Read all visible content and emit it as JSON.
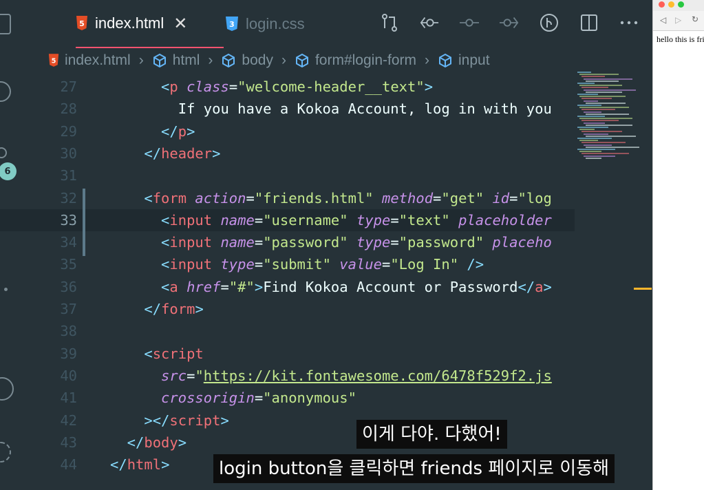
{
  "activity_bar": {
    "badge": "6"
  },
  "tabs": [
    {
      "label": "index.html",
      "icon": "html5-icon",
      "active": true
    },
    {
      "label": "login.css",
      "icon": "css3-icon",
      "active": false
    }
  ],
  "toolbar": [
    "compare-changes-icon",
    "go-back-commit-icon",
    "commit-icon",
    "go-forward-commit-icon",
    "git-lens-icon",
    "split-editor-icon",
    "more-icon"
  ],
  "breadcrumb": [
    "index.html",
    "html",
    "body",
    "form#login-form",
    "input"
  ],
  "editor": {
    "lines": [
      {
        "n": "27",
        "tokens": [
          [
            "t",
            "      <"
          ],
          [
            "n",
            "p"
          ],
          [
            "a",
            " class"
          ],
          [
            "p",
            "="
          ],
          [
            "s",
            "\"welcome-header__text\""
          ],
          [
            "t",
            ">"
          ]
        ]
      },
      {
        "n": "28",
        "tokens": [
          [
            "w",
            "        If you have a Kokoa Account, log in with you"
          ]
        ]
      },
      {
        "n": "29",
        "tokens": [
          [
            "t",
            "      </"
          ],
          [
            "n",
            "p"
          ],
          [
            "t",
            ">"
          ]
        ]
      },
      {
        "n": "30",
        "tokens": [
          [
            "t",
            "    </"
          ],
          [
            "n",
            "header"
          ],
          [
            "t",
            ">"
          ]
        ]
      },
      {
        "n": "31",
        "tokens": []
      },
      {
        "n": "32",
        "tokens": [
          [
            "t",
            "    <"
          ],
          [
            "n",
            "form"
          ],
          [
            "a",
            " action"
          ],
          [
            "p",
            "="
          ],
          [
            "s",
            "\"friends.html\""
          ],
          [
            "a",
            " method"
          ],
          [
            "p",
            "="
          ],
          [
            "s",
            "\"get\""
          ],
          [
            "a",
            " id"
          ],
          [
            "p",
            "="
          ],
          [
            "s",
            "\"log"
          ]
        ]
      },
      {
        "n": "33",
        "tokens": [
          [
            "t",
            "      <"
          ],
          [
            "n",
            "input"
          ],
          [
            "a",
            " name"
          ],
          [
            "p",
            "="
          ],
          [
            "s",
            "\"username\""
          ],
          [
            "a",
            " type"
          ],
          [
            "p",
            "="
          ],
          [
            "s",
            "\"text\""
          ],
          [
            "a",
            " placeholder"
          ]
        ]
      },
      {
        "n": "34",
        "tokens": [
          [
            "t",
            "      <"
          ],
          [
            "n",
            "input"
          ],
          [
            "a",
            " name"
          ],
          [
            "p",
            "="
          ],
          [
            "s",
            "\"password\""
          ],
          [
            "a",
            " type"
          ],
          [
            "p",
            "="
          ],
          [
            "s",
            "\"password\""
          ],
          [
            "a",
            " placeho"
          ]
        ]
      },
      {
        "n": "35",
        "tokens": [
          [
            "t",
            "      <"
          ],
          [
            "n",
            "input"
          ],
          [
            "a",
            " type"
          ],
          [
            "p",
            "="
          ],
          [
            "s",
            "\"submit\""
          ],
          [
            "a",
            " value"
          ],
          [
            "p",
            "="
          ],
          [
            "s",
            "\"Log In\""
          ],
          [
            "t",
            " />"
          ]
        ]
      },
      {
        "n": "36",
        "tokens": [
          [
            "t",
            "      <"
          ],
          [
            "n",
            "a"
          ],
          [
            "a",
            " href"
          ],
          [
            "p",
            "="
          ],
          [
            "s",
            "\"#\""
          ],
          [
            "t",
            ">"
          ],
          [
            "w",
            "Find Kokoa Account or Password"
          ],
          [
            "t",
            "</"
          ],
          [
            "n",
            "a"
          ],
          [
            "t",
            ">"
          ]
        ]
      },
      {
        "n": "37",
        "tokens": [
          [
            "t",
            "    </"
          ],
          [
            "n",
            "form"
          ],
          [
            "t",
            ">"
          ]
        ]
      },
      {
        "n": "38",
        "tokens": []
      },
      {
        "n": "39",
        "tokens": [
          [
            "t",
            "    <"
          ],
          [
            "n",
            "script"
          ]
        ]
      },
      {
        "n": "40",
        "tokens": [
          [
            "a",
            "      src"
          ],
          [
            "p",
            "="
          ],
          [
            "s",
            "\""
          ],
          [
            "su",
            "https://kit.fontawesome.com/6478f529f2.js"
          ]
        ]
      },
      {
        "n": "41",
        "tokens": [
          [
            "a",
            "      crossorigin"
          ],
          [
            "p",
            "="
          ],
          [
            "s",
            "\"anonymous\""
          ]
        ]
      },
      {
        "n": "42",
        "tokens": [
          [
            "t",
            "    ></"
          ],
          [
            "n",
            "script"
          ],
          [
            "t",
            ">"
          ]
        ]
      },
      {
        "n": "43",
        "tokens": [
          [
            "t",
            "  </"
          ],
          [
            "n",
            "body"
          ],
          [
            "t",
            ">"
          ]
        ]
      },
      {
        "n": "44",
        "tokens": [
          [
            "t",
            "</"
          ],
          [
            "n",
            "html"
          ],
          [
            "t",
            ">"
          ]
        ]
      }
    ]
  },
  "preview": {
    "text": "hello this is frie"
  },
  "subtitles": {
    "line1": "이게 다야. 다했어!",
    "line2": "login button을 클릭하면 friends 페이지로 이동해"
  },
  "colors": {
    "bg": "#263238",
    "tag": "#89ddff",
    "tagname": "#f07178",
    "attr": "#c792ea",
    "string": "#c3e88d",
    "accent": "#ff5370"
  }
}
